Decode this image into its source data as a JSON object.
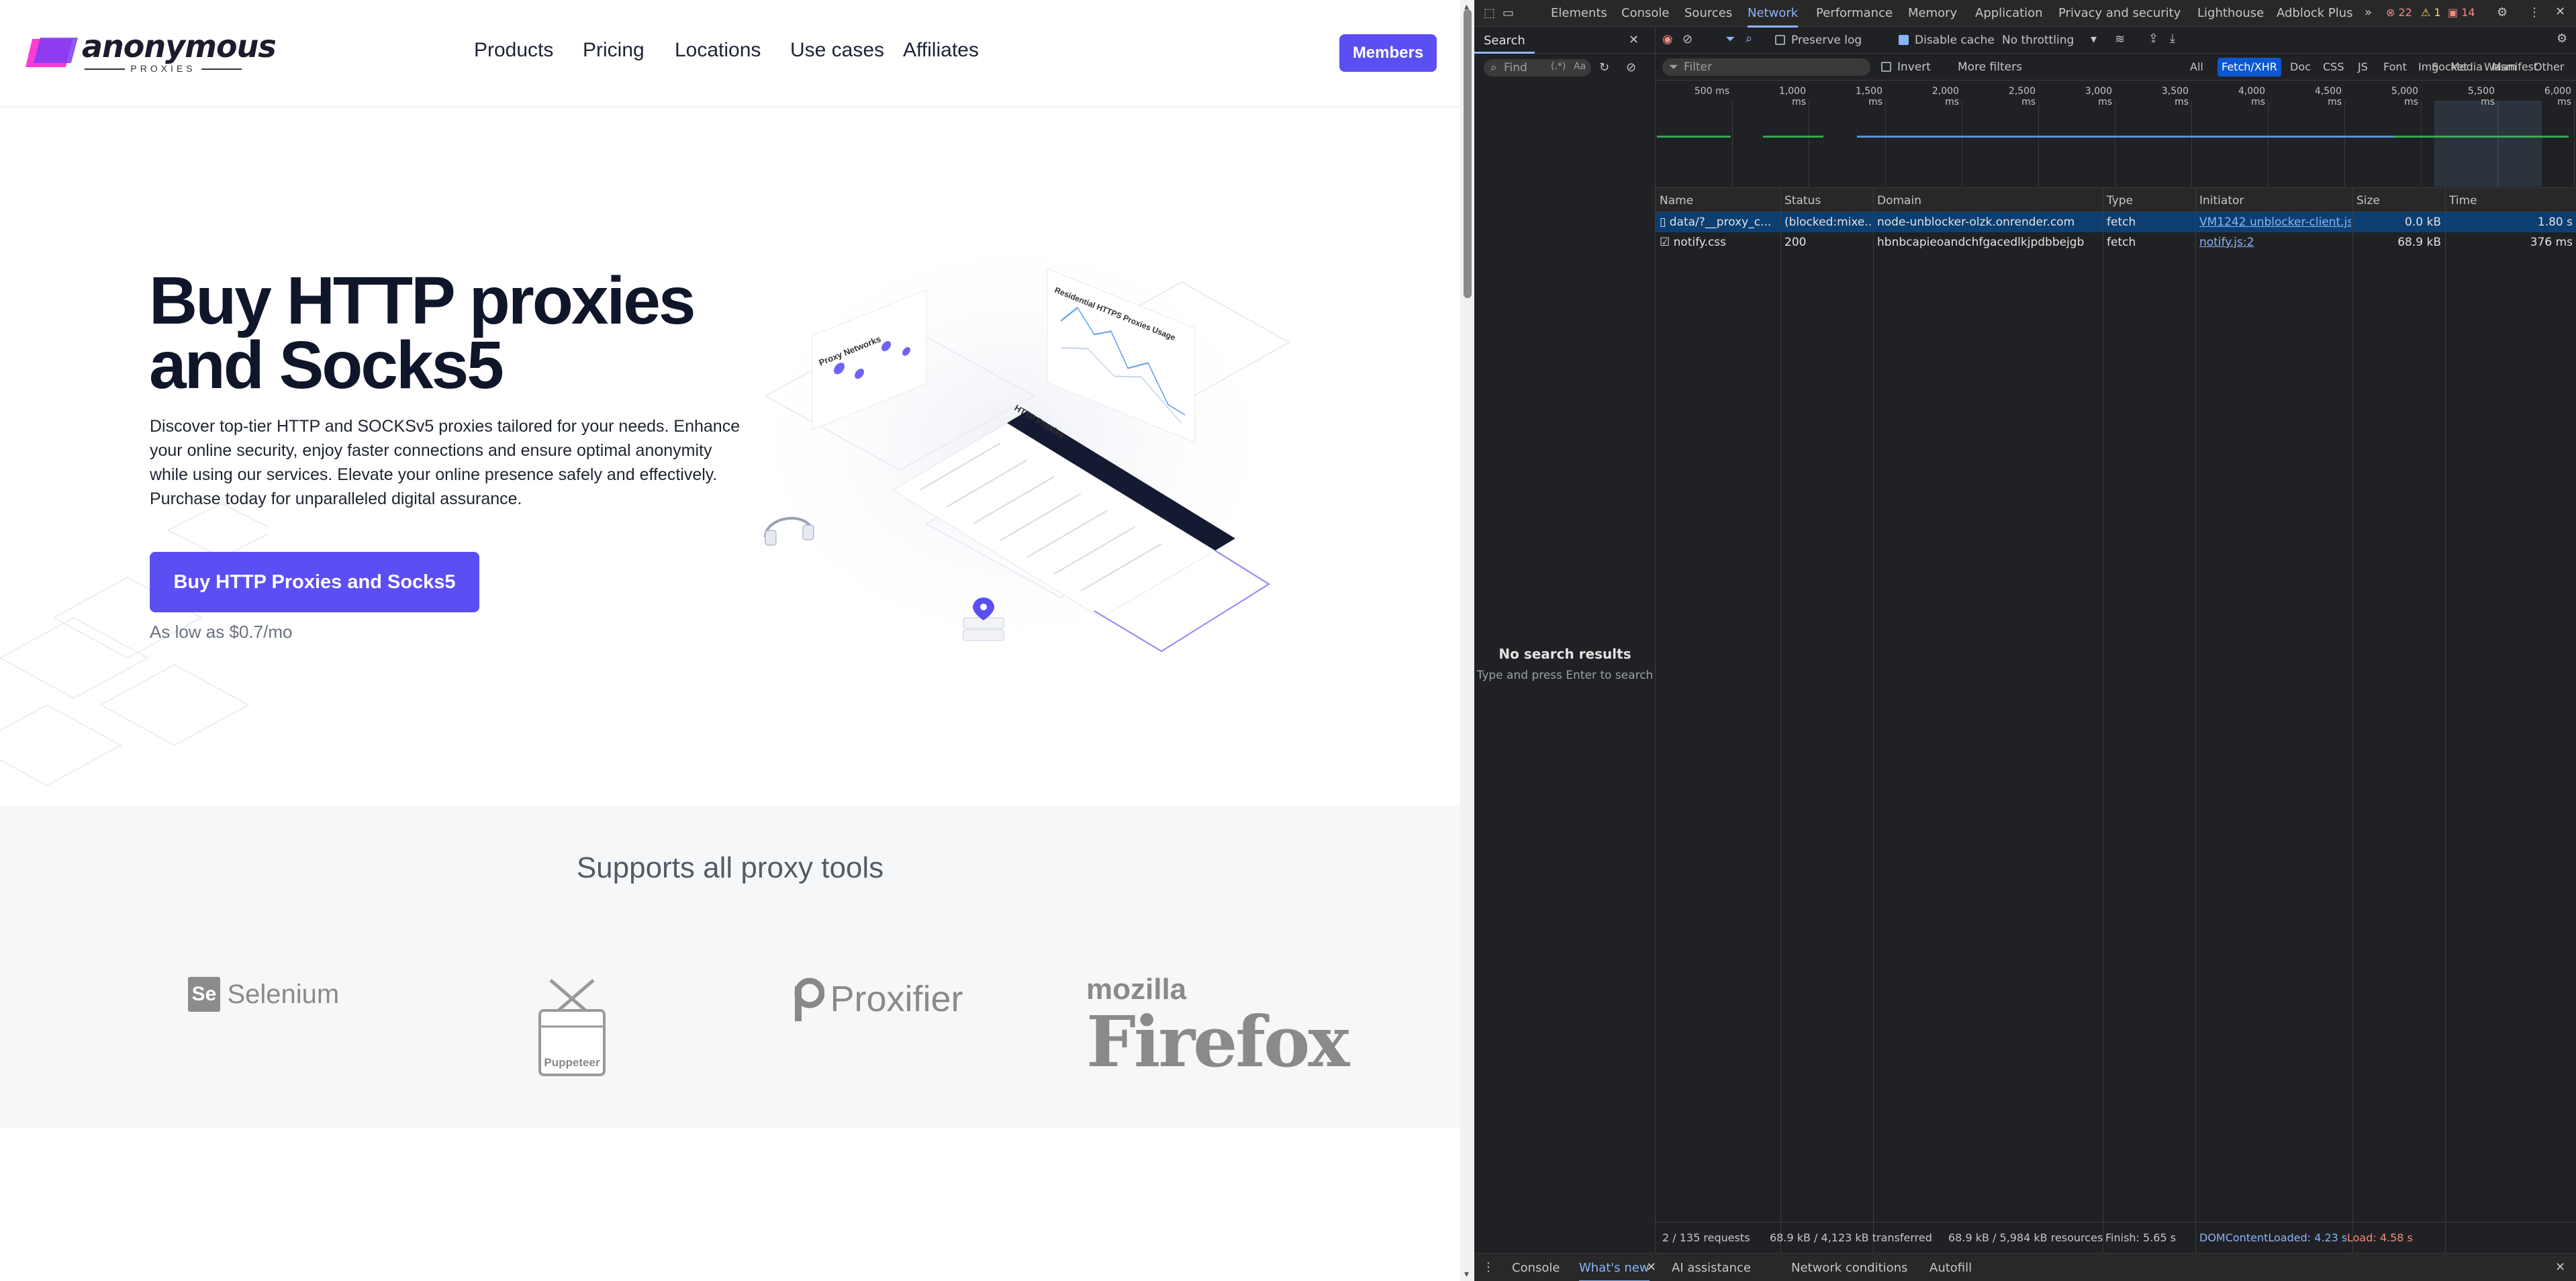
{
  "site": {
    "brand": "anonymous",
    "brand_sub": "PROXIES",
    "nav": [
      "Products",
      "Pricing",
      "Locations",
      "Use cases",
      "Affiliates"
    ],
    "members_label": "Members",
    "hero_title_1": "Buy HTTP proxies",
    "hero_title_2": "and Socks5",
    "hero_desc": "Discover top-tier HTTP and SOCKSv5 proxies tailored for your needs. Enhance your online security, enjoy faster connections and ensure optimal anonymity while using our services. Elevate your online presence safely and effectively. Purchase today for unparalleled digital assurance.",
    "cta_label": "Buy HTTP Proxies and Socks5",
    "price_note": "As low as $0.7/mo",
    "illus_labels": {
      "proxy_networks": "Proxy Networks",
      "usage": "Residential HTTPS Proxies Usage",
      "http_proxies": "HTTP Proxies"
    },
    "supports_title": "Supports all proxy tools",
    "tools": {
      "selenium": "Selenium",
      "selenium_mark": "Se",
      "puppeteer": "Puppeteer",
      "proxifier": "Proxifier",
      "firefox_top": "mozilla",
      "firefox": "Firefox"
    }
  },
  "devtools": {
    "tabs": [
      "Elements",
      "Console",
      "Sources",
      "Network",
      "Performance",
      "Memory",
      "Application",
      "Privacy and security",
      "Lighthouse",
      "Adblock Plus"
    ],
    "active_tab": "Network",
    "errors": "22",
    "warnings": "1",
    "issues": "14",
    "search": {
      "title": "Search",
      "find_placeholder": "Find",
      "regex": "(.*)",
      "case": "Aa",
      "no_results": "No search results",
      "hint": "Type and press Enter to search"
    },
    "toolbar": {
      "preserve_log": "Preserve log",
      "disable_cache": "Disable cache",
      "throttling": "No throttling"
    },
    "filter": {
      "placeholder": "Filter",
      "invert": "Invert",
      "more_filters": "More filters",
      "types": [
        "All",
        "Fetch/XHR",
        "Doc",
        "CSS",
        "JS",
        "Font",
        "Img",
        "Media",
        "Manifest",
        "Socket",
        "Wasm",
        "Other"
      ],
      "active_type": "Fetch/XHR"
    },
    "ticks": [
      "500 ms",
      "1,000 ms",
      "1,500 ms",
      "2,000 ms",
      "2,500 ms",
      "3,000 ms",
      "3,500 ms",
      "4,000 ms",
      "4,500 ms",
      "5,000 ms",
      "5,500 ms",
      "6,000 ms"
    ],
    "columns": [
      "Name",
      "Status",
      "Domain",
      "Type",
      "Initiator",
      "Size",
      "Time"
    ],
    "rows": [
      {
        "name": "data/?__proxy_c...",
        "status": "(blocked:mixe...",
        "domain": "node-unblocker-olzk.onrender.com",
        "type": "fetch",
        "initiator": "VM1242 unblocker-client.js:1",
        "size": "0.0 kB",
        "time": "1.80 s"
      },
      {
        "name": "notify.css",
        "status": "200",
        "domain": "hbnbcapieoandchfgacedlkjpdbbejgb",
        "type": "fetch",
        "initiator": "notify.js:2",
        "size": "68.9 kB",
        "time": "376 ms"
      }
    ],
    "status": {
      "requests": "2 / 135 requests",
      "transferred": "68.9 kB / 4,123 kB transferred",
      "resources": "68.9 kB / 5,984 kB resources",
      "finish": "Finish: 5.65 s",
      "dcl": "DOMContentLoaded: 4.23 s",
      "load": "Load: 4.58 s"
    },
    "drawer_tabs": [
      "Console",
      "What's new",
      "AI assistance",
      "Network conditions",
      "Autofill"
    ],
    "active_drawer": "What's new"
  },
  "colors": {
    "accent": "#5b4ff4",
    "devtools_bg": "#202124",
    "devtools_link": "#8ab4f8"
  }
}
